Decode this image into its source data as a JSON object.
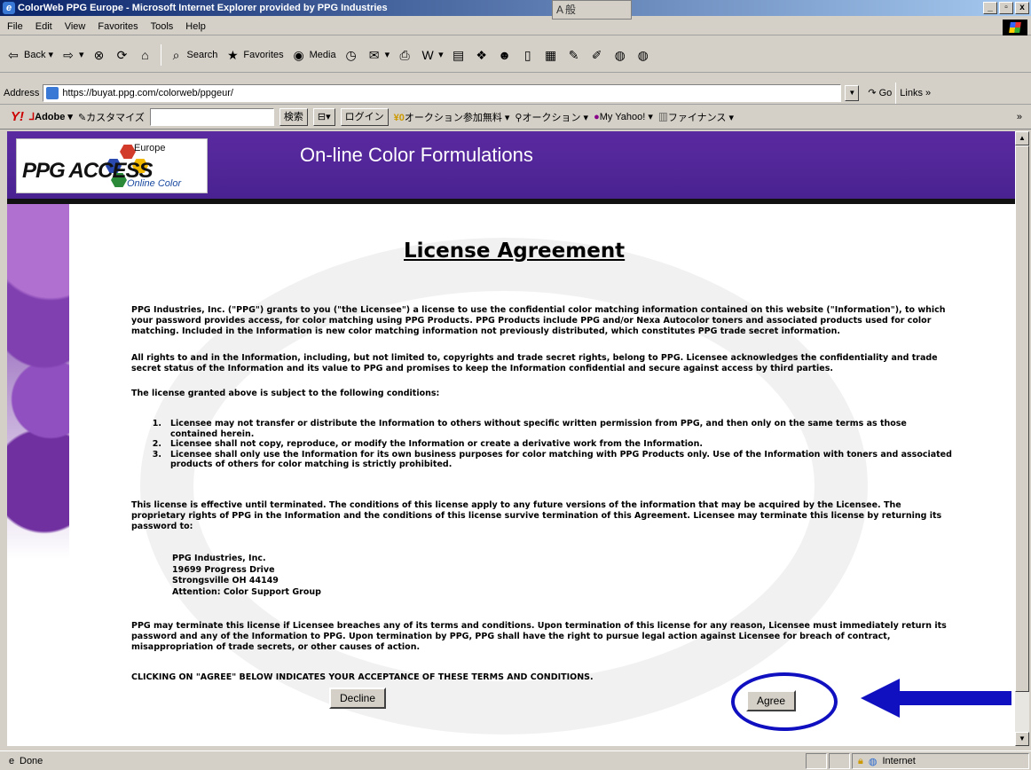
{
  "window": {
    "title": "ColorWeb PPG Europe - Microsoft Internet Explorer provided by PPG Industries",
    "ime": "A般",
    "min": "_",
    "max": "▫",
    "close": "x"
  },
  "menu": [
    "File",
    "Edit",
    "View",
    "Favorites",
    "Tools",
    "Help"
  ],
  "toolbar": {
    "back": "Back",
    "search": "Search",
    "favorites": "Favorites",
    "media": "Media"
  },
  "address": {
    "label": "Address",
    "url": "https://buyat.ppg.com/colorweb/ppgeur/",
    "go": "Go",
    "links": "Links"
  },
  "yahoo": {
    "adobe": "Adobe",
    "customize": "カスタマイズ",
    "search": "検索",
    "login": "ログイン",
    "auction_free": "オークション参加無料",
    "auction": "オークション",
    "my_yahoo": "My Yahoo!",
    "finance": "ファイナンス"
  },
  "banner": {
    "brand": "PPG",
    "access": "ACCESS",
    "region": "Europe",
    "tagline": "Online Color",
    "title": "On-line Color Formulations"
  },
  "page": {
    "heading": "License Agreement",
    "p1": "PPG Industries, Inc. (\"PPG\") grants to you (\"the Licensee\") a license to use the confidential color matching information contained on this website (\"Information\"), to which your password provides access, for color matching using PPG Products.  PPG Products include PPG and/or Nexa Autocolor toners and associated products used for color matching.  Included in the Information is new color matching information not previously distributed, which constitutes PPG trade secret information.",
    "p2": "All rights to and in the Information, including, but not limited to, copyrights and trade secret rights, belong to PPG.  Licensee acknowledges the confidentiality and trade secret status of the Information and its value to PPG and promises to keep the Information confidential and secure against access by third parties.",
    "p3": "The license granted above is subject to the following conditions:",
    "conditions": [
      {
        "n": "1.",
        "text": "Licensee may not transfer or distribute the Information to others without specific written permission from PPG, and then only on the same terms as those contained herein."
      },
      {
        "n": "2.",
        "text": "Licensee shall not copy, reproduce, or modify the Information or create a derivative work from the Information."
      },
      {
        "n": "3.",
        "text": "Licensee shall only use the Information for its own business purposes for color matching with PPG Products only.  Use of the Information with toners and associated products of others for color matching is strictly prohibited."
      }
    ],
    "p4": "This license is effective until terminated.  The conditions of this license apply to any future versions of the information that may be acquired by the Licensee.  The proprietary rights of PPG in the Information and the conditions of this license survive termination of this Agreement.  Licensee may terminate this license by returning its password to:",
    "address_lines": [
      "PPG Industries, Inc.",
      "19699 Progress Drive",
      "Strongsville  OH  44149",
      "Attention: Color Support Group"
    ],
    "p5": "PPG may terminate this license if Licensee breaches any of its terms and conditions.  Upon termination of this license for any reason, Licensee must immediately return its password and any of the Information to PPG.  Upon termination by PPG, PPG shall have the right to pursue legal action against Licensee for breach of contract, misappropriation of trade secrets, or other causes of action.",
    "p6": "CLICKING ON \"AGREE\" BELOW INDICATES YOUR ACCEPTANCE OF THESE TERMS AND CONDITIONS.",
    "decline": "Decline",
    "agree": "Agree"
  },
  "status": {
    "text": "Done",
    "zone": "Internet"
  },
  "colors": {
    "banner": "#4a2290",
    "annotation": "#1010c0"
  }
}
